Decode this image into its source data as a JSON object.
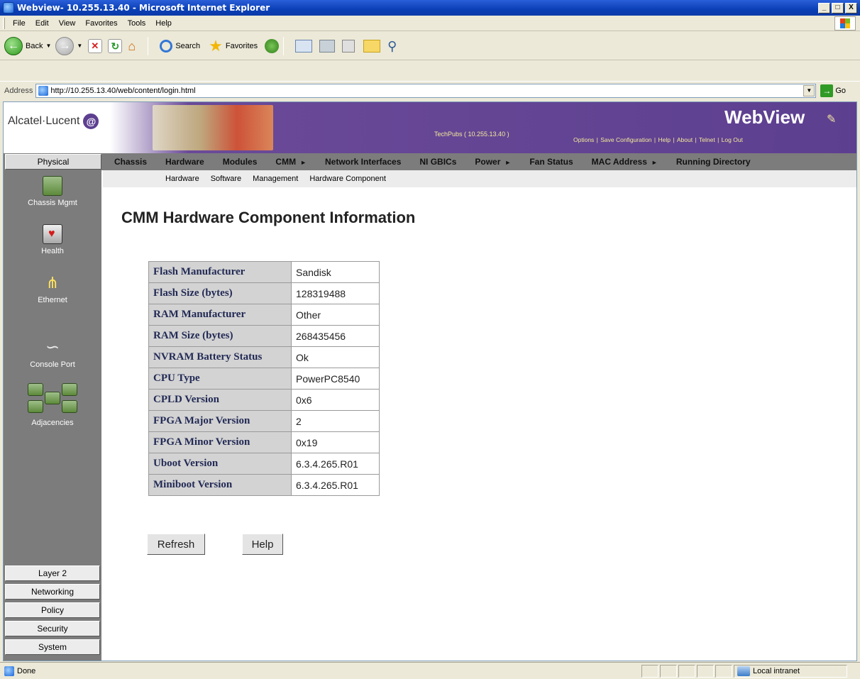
{
  "window": {
    "title": "Webview- 10.255.13.40 - Microsoft Internet Explorer",
    "controls": [
      "_",
      "□",
      "X"
    ]
  },
  "menubar": {
    "items": [
      "File",
      "Edit",
      "View",
      "Favorites",
      "Tools",
      "Help"
    ]
  },
  "toolbar": {
    "back_label": "Back",
    "search_label": "Search",
    "favorites_label": "Favorites"
  },
  "address": {
    "label": "Address",
    "url": "http://10.255.13.40/web/content/login.html",
    "go_label": "Go"
  },
  "banner": {
    "logo_text": "Alcatel·Lucent",
    "center_text": "TechPubs  ( 10.255.13.40 )",
    "brand": "WebView",
    "utility_links": [
      "Options",
      "Save Configuration",
      "Help",
      "About",
      "Telnet",
      "Log Out"
    ]
  },
  "nav": {
    "physical_label": "Physical",
    "items": [
      {
        "label": "Chassis",
        "arrow": false
      },
      {
        "label": "Hardware",
        "arrow": false
      },
      {
        "label": "Modules",
        "arrow": false
      },
      {
        "label": "CMM",
        "arrow": true
      },
      {
        "label": "Network Interfaces",
        "arrow": false
      },
      {
        "label": "NI GBICs",
        "arrow": false
      },
      {
        "label": "Power",
        "arrow": true
      },
      {
        "label": "Fan Status",
        "arrow": false
      },
      {
        "label": "MAC Address",
        "arrow": true
      },
      {
        "label": "Running Directory",
        "arrow": false
      }
    ]
  },
  "subnav": {
    "items": [
      "Hardware",
      "Software",
      "Management",
      "Hardware Component"
    ]
  },
  "sidebar": {
    "items": [
      {
        "label": "Chassis Mgmt",
        "icon": "chassis-icon"
      },
      {
        "label": "Health",
        "icon": "health-icon"
      },
      {
        "label": "Ethernet",
        "icon": "ethernet-icon"
      },
      {
        "label": "Console Port",
        "icon": "console-port-icon"
      },
      {
        "label": "Adjacencies",
        "icon": "adjacencies-icon"
      }
    ],
    "buttons": [
      "Layer 2",
      "Networking",
      "Policy",
      "Security",
      "System"
    ]
  },
  "main": {
    "title": "CMM Hardware Component Information",
    "table": [
      {
        "key": "Flash Manufacturer",
        "value": "Sandisk"
      },
      {
        "key": "Flash Size (bytes)",
        "value": "128319488"
      },
      {
        "key": "RAM Manufacturer",
        "value": "Other"
      },
      {
        "key": "RAM Size (bytes)",
        "value": "268435456"
      },
      {
        "key": "NVRAM Battery Status",
        "value": "Ok"
      },
      {
        "key": "CPU Type",
        "value": "PowerPC8540"
      },
      {
        "key": "CPLD Version",
        "value": "0x6"
      },
      {
        "key": "FPGA Major Version",
        "value": "2"
      },
      {
        "key": "FPGA Minor Version",
        "value": "0x19"
      },
      {
        "key": "Uboot Version",
        "value": "6.3.4.265.R01"
      },
      {
        "key": "Miniboot Version",
        "value": "6.3.4.265.R01"
      }
    ],
    "refresh_label": "Refresh",
    "help_label": "Help"
  },
  "status": {
    "text": "Done",
    "zone": "Local intranet"
  },
  "colors": {
    "banner_purple": "#5d3f90",
    "nav_gray": "#7c7c7c",
    "label_cell": "#d3d3d3"
  }
}
